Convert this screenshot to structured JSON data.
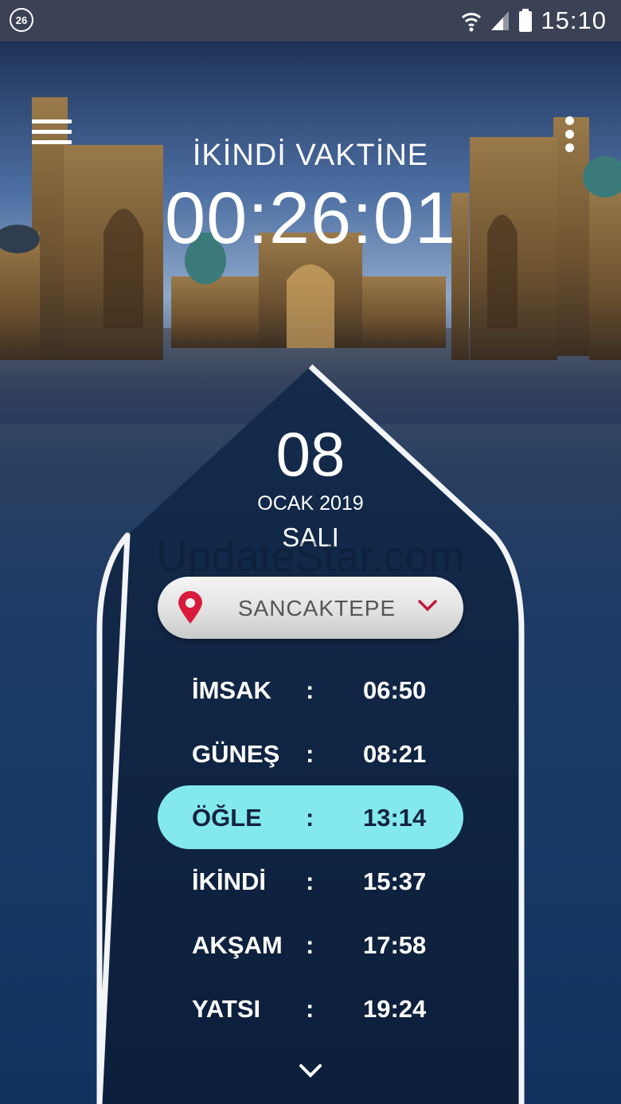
{
  "status_bar": {
    "badge": "26",
    "time": "15:10",
    "icons": [
      "wifi-icon",
      "signal-icon",
      "battery-icon"
    ]
  },
  "header": {
    "countdown_label": "İKİNDİ VAKTİNE",
    "countdown": "00:26:01",
    "icons": [
      "menu-icon",
      "more-vert-icon"
    ]
  },
  "date": {
    "day": "08",
    "month_year": "OCAK 2019",
    "weekday": "SALI"
  },
  "watermark": "UpdateStar.com",
  "location": {
    "name": "SANCAKTEPE",
    "pin_color": "#d81b3c"
  },
  "prayer_times": [
    {
      "name": "İMSAK",
      "separator": ":",
      "time": "06:50",
      "active": false
    },
    {
      "name": "GÜNEŞ",
      "separator": ":",
      "time": "08:21",
      "active": false
    },
    {
      "name": "ÖĞLE",
      "separator": ":",
      "time": "13:14",
      "active": true
    },
    {
      "name": "İKİNDİ",
      "separator": ":",
      "time": "15:37",
      "active": false
    },
    {
      "name": "AKŞAM",
      "separator": ":",
      "time": "17:58",
      "active": false
    },
    {
      "name": "YATSI",
      "separator": ":",
      "time": "19:24",
      "active": false
    }
  ],
  "colors": {
    "highlight": "#84e9ef",
    "panel": "#0d2240",
    "status_bar": "#3b4256"
  }
}
